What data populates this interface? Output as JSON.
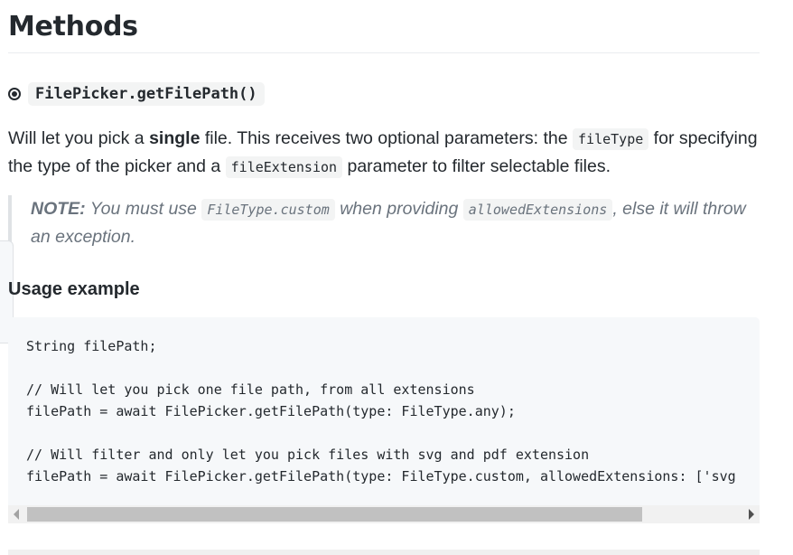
{
  "heading": "Methods",
  "method": {
    "signature": "FilePicker.getFilePath()"
  },
  "description": {
    "p1": "Will let you pick a ",
    "bold": "single",
    "p2": " file. This receives two optional parameters: the ",
    "code1": "fileType",
    "p3": " for specifying the type of the picker and a ",
    "code2": "fileExtension",
    "p4": " parameter to filter selectable files."
  },
  "note": {
    "label": "NOTE:",
    "t1": " You must use ",
    "code1": "FileType.custom",
    "t2": " when providing ",
    "code2": "allowedExtensions",
    "t3": ", else it will throw an exception."
  },
  "usage_heading": "Usage example",
  "code_lines": [
    "String filePath;",
    "",
    "// Will let you pick one file path, from all extensions",
    "filePath = await FilePicker.getFilePath(type: FileType.any);",
    "",
    "// Will filter and only let you pick files with svg and pdf extension",
    "filePath = await FilePicker.getFilePath(type: FileType.custom, allowedExtensions: ['svg"
  ]
}
